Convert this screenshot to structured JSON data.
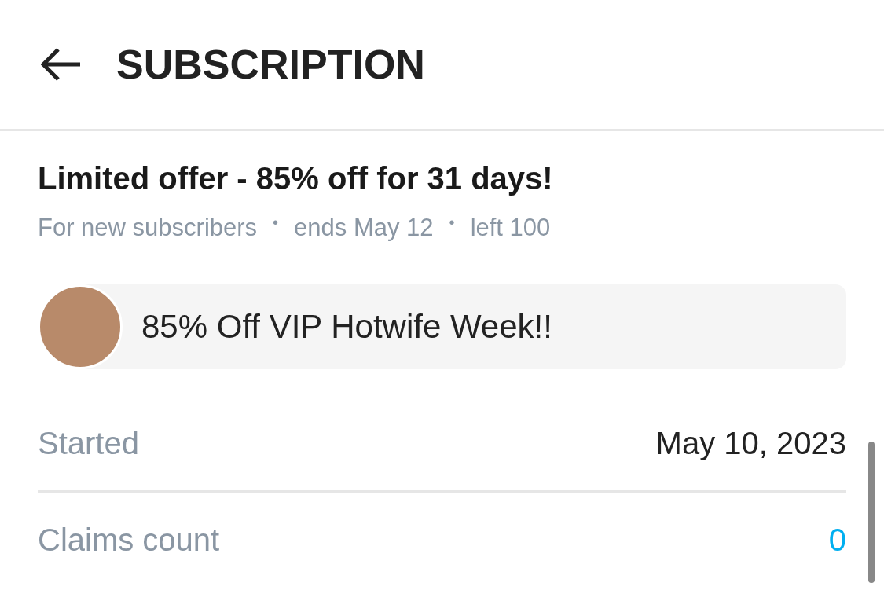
{
  "header": {
    "title": "SUBSCRIPTION"
  },
  "offer": {
    "title": "Limited offer - 85% off for 31 days!",
    "separator": "•",
    "details": [
      "For new subscribers",
      "ends May 12",
      "left 100"
    ]
  },
  "promo": {
    "message": "85% Off VIP Hotwife Week!!"
  },
  "rows": [
    {
      "label": "Started",
      "value": "May 10, 2023",
      "kind": "text"
    },
    {
      "label": "Claims count",
      "value": "0",
      "kind": "link"
    }
  ]
}
